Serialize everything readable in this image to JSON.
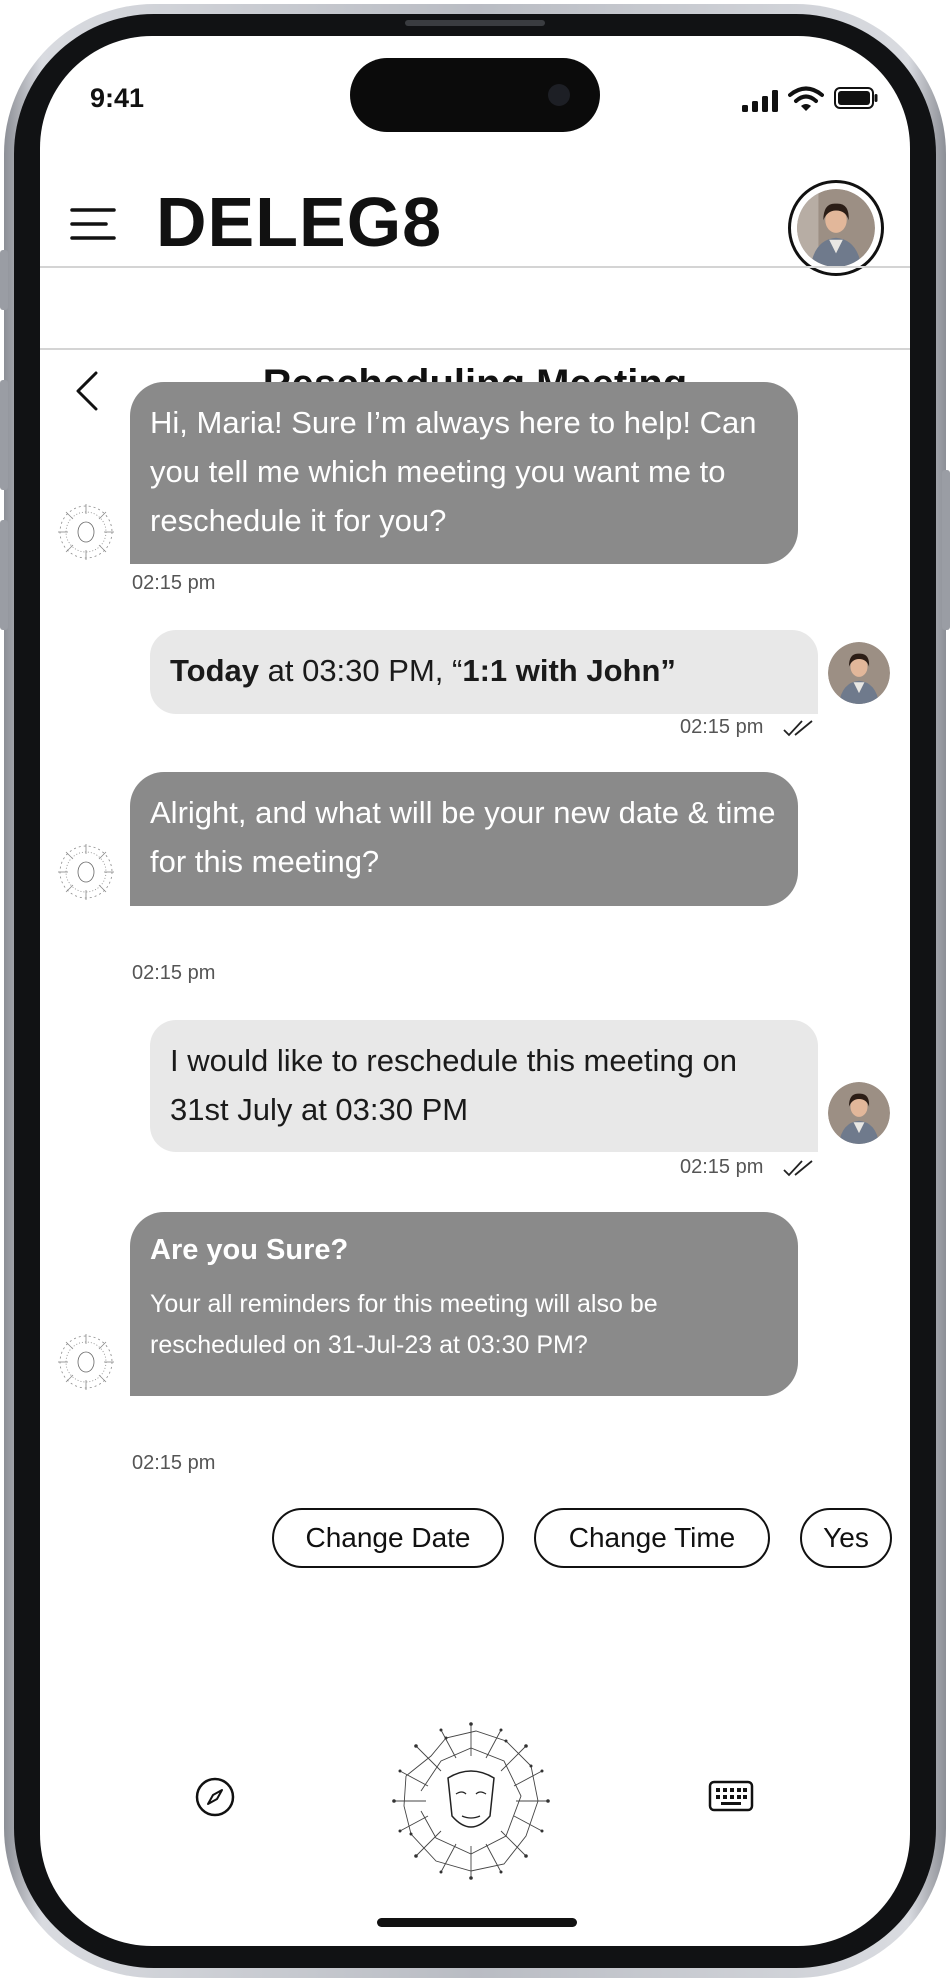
{
  "status_bar": {
    "time": "9:41"
  },
  "header": {
    "app_name": "DELEG8"
  },
  "chat": {
    "title": "Rescheduling Meeting"
  },
  "messages": [
    {
      "sender": "bot",
      "text": "Hi, Maria! Sure I’m always here to help! Can you tell me which meeting you want me to reschedule it for you?",
      "time": "02:15 pm"
    },
    {
      "sender": "user",
      "bold": "Today",
      "text": " at 03:30 PM, “",
      "text_bold_end": "1:1 with John”",
      "time": "02:15 pm"
    },
    {
      "sender": "bot",
      "text": "Alright, and what will be your new date & time for this meeting?",
      "time": "02:15 pm"
    },
    {
      "sender": "user",
      "text": "I would like to reschedule this meeting on 31st July at 03:30 PM",
      "time": "02:15 pm"
    },
    {
      "sender": "bot",
      "title": "Are you Sure?",
      "text": "Your all reminders for this meeting will also be rescheduled on 31-Jul-23 at 03:30 PM?",
      "time": "02:15 pm"
    }
  ],
  "quick_replies": [
    "Change Date",
    "Change Time",
    "Yes"
  ],
  "colors": {
    "bot_bubble": "#8a8a8a",
    "user_bubble": "#e8e8e8",
    "text": "#111111"
  },
  "icons": {
    "menu": "menu-icon",
    "back": "chevron-left-icon",
    "compass": "compass-icon",
    "keyboard": "keyboard-icon",
    "read": "double-check-icon"
  }
}
